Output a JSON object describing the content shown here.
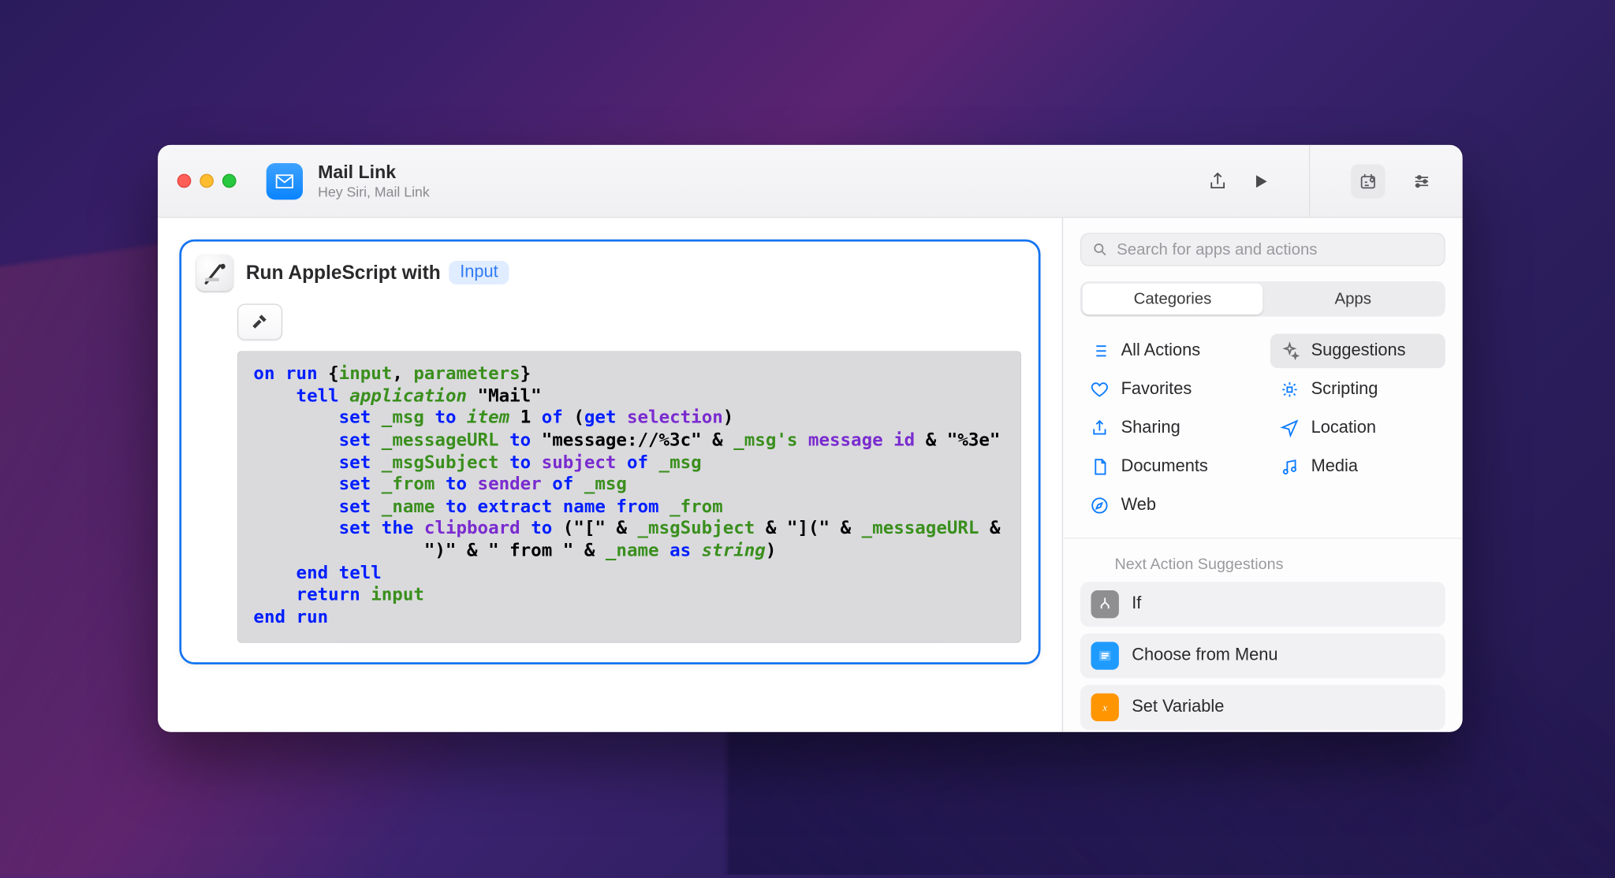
{
  "window": {
    "title": "Mail Link",
    "subtitle": "Hey Siri, Mail Link"
  },
  "action": {
    "title_prefix": "Run AppleScript with",
    "input_pill": "Input"
  },
  "code": {
    "on": "on",
    "run": "run",
    "lb": "{",
    "input": "input",
    "comma": ", ",
    "parameters": "parameters",
    "rb": "}",
    "tell": "tell",
    "application": "application",
    "mail_q": "\"Mail\"",
    "set": "set",
    "msg": "_msg",
    "to": "to",
    "item": "item",
    "one": "1",
    "of": "of",
    "lp": "(",
    "get": "get",
    "selection": "selection",
    "rp": ")",
    "messageURL": "_messageURL",
    "msg_str_a": "\"message://%3c\"",
    "amp": " & ",
    "msgs": "_msg's",
    "message_id": "message id",
    "msg_str_b": "\"%3e\"",
    "msgSubject": "_msgSubject",
    "subject": "subject",
    "fromv": "_from",
    "sender": "sender",
    "namev": "_name",
    "extract": "extract name from",
    "the": "the",
    "clipboard": "clipboard",
    "br_open": "(\"[\"",
    "mid1": "\"](\"",
    "line8_tail_a": "\")\"",
    "from_str": "\" from \"",
    "as": "as",
    "string": "string",
    "rp2": ")",
    "end": "end",
    "return": "return",
    "tell2": "tell"
  },
  "sidebar": {
    "search_placeholder": "Search for apps and actions",
    "seg": {
      "categories": "Categories",
      "apps": "Apps"
    },
    "cats": {
      "all": "All Actions",
      "suggestions": "Suggestions",
      "favorites": "Favorites",
      "scripting": "Scripting",
      "sharing": "Sharing",
      "location": "Location",
      "documents": "Documents",
      "media": "Media",
      "web": "Web"
    },
    "next_header": "Next Action Suggestions",
    "next": {
      "if": "If",
      "choose": "Choose from Menu",
      "setvar": "Set Variable"
    }
  }
}
